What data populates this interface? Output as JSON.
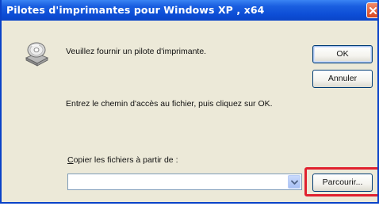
{
  "window": {
    "title": "Pilotes d'imprimantes pour Windows XP , x64"
  },
  "dialog": {
    "prompt": "Veuillez fournir un pilote d'imprimante.",
    "instruction": "Entrez le chemin d'accès au fichier, puis cliquez sur OK.",
    "copy_label_accel": "C",
    "copy_label_rest": "opier les fichiers à partir de :",
    "path_value": "",
    "ok_label": "OK",
    "cancel_label": "Annuler",
    "browse_accel": "P",
    "browse_rest": "arcourir..."
  },
  "icons": {
    "title_close": "close-icon",
    "disk": "disk-drive-icon",
    "dropdown": "chevron-down-icon"
  },
  "colors": {
    "titlebar": "#0d4ed6",
    "highlight": "#e0212e",
    "dialog_bg": "#ece9d8"
  }
}
